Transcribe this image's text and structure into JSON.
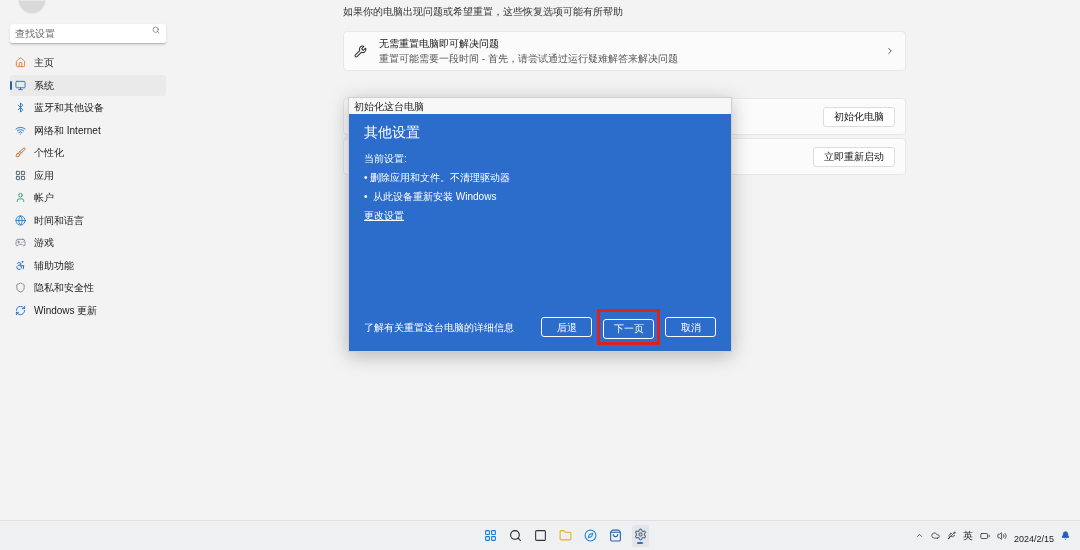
{
  "sidebar": {
    "search": {
      "placeholder": "查找设置"
    },
    "items": [
      {
        "label": "主页",
        "selected": false
      },
      {
        "label": "系统",
        "selected": true
      },
      {
        "label": "蓝牙和其他设备",
        "selected": false
      },
      {
        "label": "网络和 Internet",
        "selected": false
      },
      {
        "label": "个性化",
        "selected": false
      },
      {
        "label": "应用",
        "selected": false
      },
      {
        "label": "帐户",
        "selected": false
      },
      {
        "label": "时间和语言",
        "selected": false
      },
      {
        "label": "游戏",
        "selected": false
      },
      {
        "label": "辅助功能",
        "selected": false
      },
      {
        "label": "隐私和安全性",
        "selected": false
      },
      {
        "label": "Windows 更新",
        "selected": false
      }
    ]
  },
  "main": {
    "intro": "如果你的电脑出现问题或希望重置，这些恢复选项可能有所帮助",
    "fix_card": {
      "title": "无需重置电脑即可解决问题",
      "subtitle": "重置可能需要一段时间 - 首先，请尝试通过运行疑难解答来解决问题"
    },
    "option_buttons": [
      "初始化电脑",
      "立即重新启动"
    ]
  },
  "dialog": {
    "title": "初始化这台电脑",
    "heading": "其他设置",
    "current_label": "当前设置:",
    "bullets": [
      "• 删除应用和文件。不清理驱动器",
      "•  从此设备重新安装 Windows"
    ],
    "change_link": "更改设置",
    "learn_more": "了解有关重置这台电脑的详细信息",
    "buttons": [
      {
        "label": "后退",
        "highlighted": false
      },
      {
        "label": "下一页",
        "highlighted": true
      },
      {
        "label": "取消",
        "highlighted": false
      }
    ]
  },
  "taskbar": {
    "apps": [
      {
        "active": false
      },
      {
        "active": false
      },
      {
        "active": false
      },
      {
        "active": false
      },
      {
        "active": false
      },
      {
        "active": false
      },
      {
        "active": true
      }
    ],
    "language": "英",
    "date": "2024/2/15"
  }
}
